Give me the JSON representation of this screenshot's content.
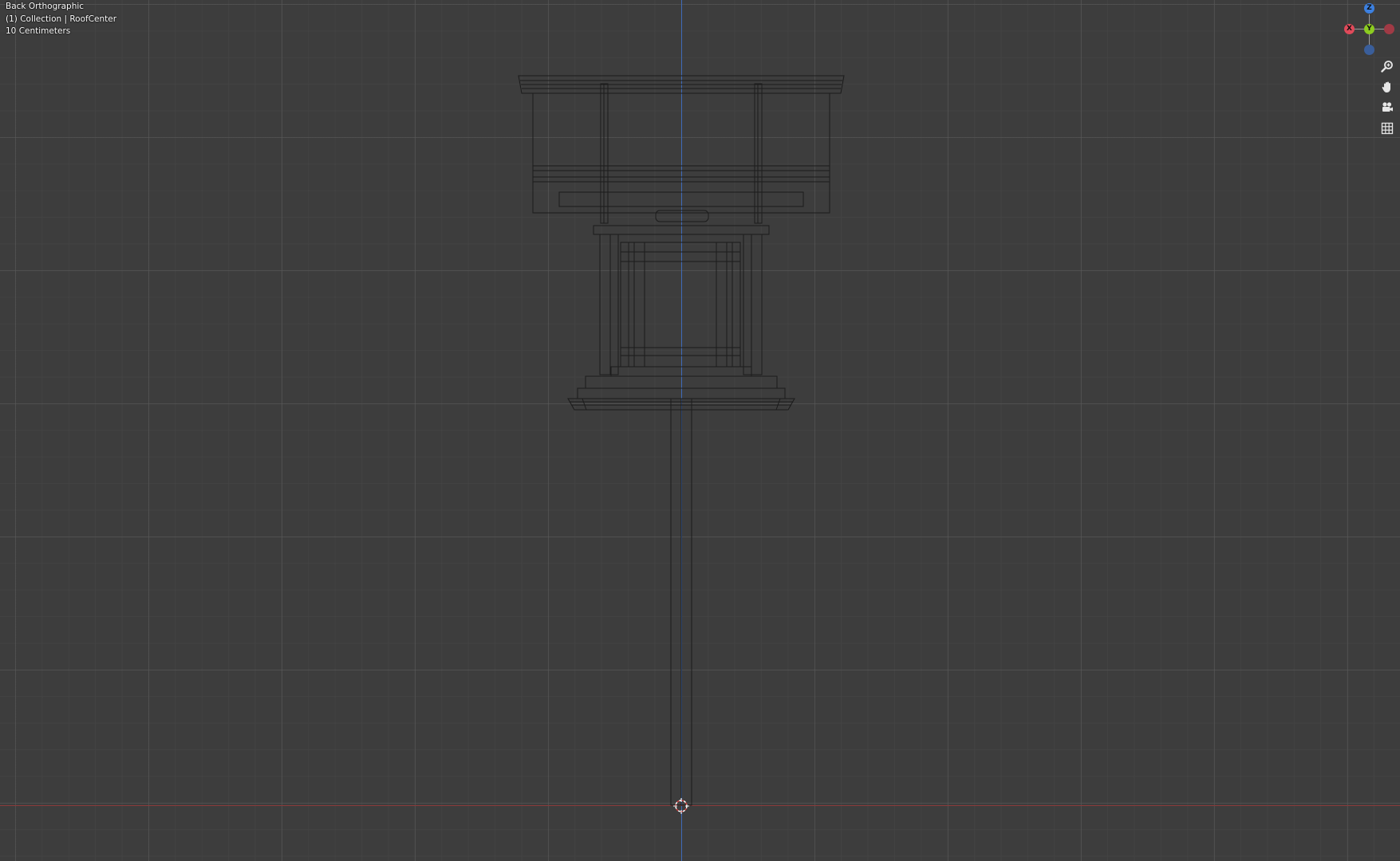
{
  "viewport": {
    "view_name": "Back Orthographic",
    "collection_label": "(1) Collection | RoofCenter",
    "grid_scale": "10 Centimeters",
    "grid_color": "#3d3d3d",
    "z_axis_color": "#3f6bb8",
    "x_axis_color": "#8a3a3a"
  },
  "gizmo": {
    "z_label": "Z",
    "x_label": "X",
    "y_label": "Y",
    "z_color": "#3c80e0",
    "neg_z_color": "#3a5e9a",
    "x_color": "#e04a5a",
    "neg_x_color": "#a03a45",
    "y_color": "#8ccc20"
  },
  "nav_tools": [
    {
      "icon": "zoom-icon"
    },
    {
      "icon": "hand-pan-icon"
    },
    {
      "icon": "camera-icon"
    },
    {
      "icon": "grid-icon"
    }
  ]
}
